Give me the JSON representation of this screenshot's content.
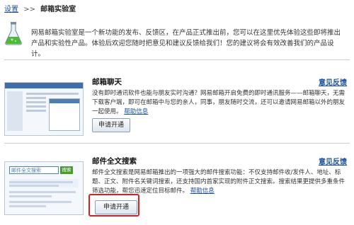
{
  "breadcrumb": {
    "settings_link": "设置",
    "separator": ">>",
    "current": "邮箱实验室"
  },
  "intro": {
    "text": "网易邮箱实验室是一个新功能的发布、反馈区，在产品正式推出前，您可以在这里优先体验这些即将推出产品和实验性产品。体验后欢迎您随时把意见和建议反馈给我们！您的建议将会有效改善我们的产品设计。"
  },
  "features": [
    {
      "title": "邮箱聊天",
      "feedback_label": "意见反馈",
      "description": "没有即时通讯软件也能与朋友实时沟通？网易邮箱开启免费的即时通讯服务——邮箱聊天，无需下载客户端，即可在邮箱中与您的亲人，同事，朋友随时交流，还可以邀请网易邮箱以外的朋友一起使用。",
      "help_label": "帮助信息",
      "button_label": "申请开通"
    },
    {
      "title": "邮件全文搜索",
      "feedback_label": "意见反馈",
      "description": "邮件全文搜索是网易邮箱推出的一项强大的邮件搜索功能：不仅支持邮件收/发件人、地址、标题、正文、附件名关键词搜索，还支持国内首家实现的附件正文搜索。搜索结果更提供多重条件筛选功能，帮您迅速定位目标邮件。",
      "help_label": "帮助信息",
      "button_label": "申请开通",
      "thumbnail": {
        "search_placeholder": "邮件全文搜索",
        "search_button": "搜索"
      }
    }
  ],
  "colors": {
    "link": "#1a4fa0",
    "highlight": "#d81f26",
    "divider": "#cfcfcf"
  }
}
